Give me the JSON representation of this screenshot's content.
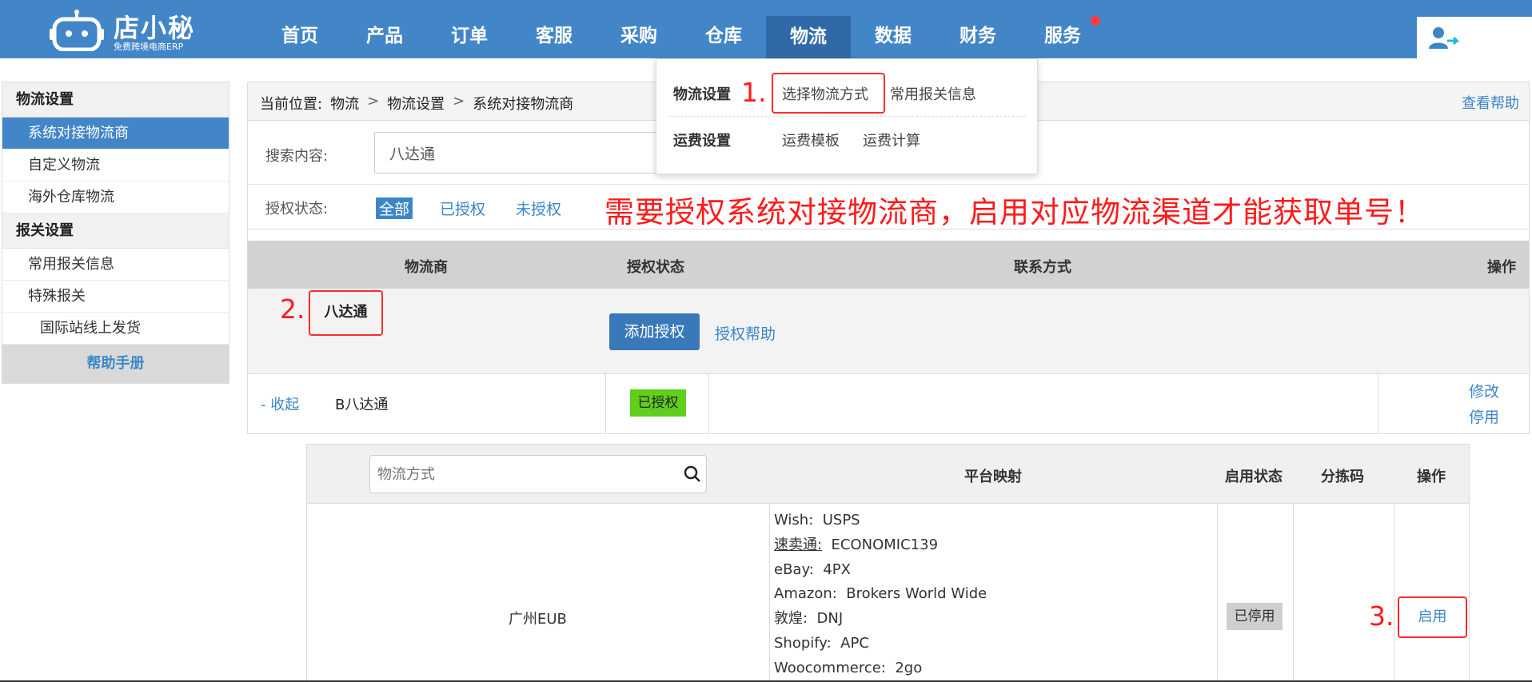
{
  "header": {
    "logo_name": "店小秘",
    "logo_sub": "免费跨境电商ERP",
    "nav": [
      "首页",
      "产品",
      "订单",
      "客服",
      "采购",
      "仓库",
      "物流",
      "数据",
      "财务",
      "服务"
    ],
    "active_nav": "物流",
    "colors": {
      "bar": "#4386c8",
      "active": "#3169a8",
      "dot": "#ff3b3b"
    }
  },
  "dropdown": {
    "group1_label": "物流设置",
    "group1_items": [
      "选择物流方式",
      "常用报关信息"
    ],
    "group2_label": "运费设置",
    "group2_items": [
      "运费模板",
      "运费计算"
    ],
    "annotation": "1."
  },
  "sidebar": {
    "section1": "物流设置",
    "section1_items": [
      "系统对接物流商",
      "自定义物流",
      "海外仓库物流"
    ],
    "section2": "报关设置",
    "section2_items": [
      "常用报关信息",
      "特殊报关"
    ],
    "sub_item": "国际站线上发货",
    "help": "帮助手册"
  },
  "breadcrumb": {
    "prefix": "当前位置:",
    "parts": [
      "物流",
      "物流设置",
      "系统对接物流商"
    ],
    "sep": ">",
    "help_link": "查看帮助"
  },
  "search": {
    "label": "搜索内容:",
    "value": "八达通"
  },
  "auth_filter": {
    "label": "授权状态:",
    "options": [
      "全部",
      "已授权",
      "未授权"
    ],
    "selected": "全部"
  },
  "notice": "需要授权系统对接物流商，启用对应物流渠道才能获取单号！",
  "table": {
    "headers": [
      "物流商",
      "授权状态",
      "联系方式",
      "操作"
    ],
    "provider": "八达通",
    "provider_annotation": "2.",
    "add_auth_button": "添加授权",
    "auth_help": "授权帮助",
    "row": {
      "collapse": "- 收起",
      "account": "B八达通",
      "status": "已授权",
      "ops": [
        "修改",
        "停用"
      ]
    }
  },
  "subtable": {
    "search_placeholder": "物流方式",
    "headers": [
      "平台映射",
      "启用状态",
      "分拣码",
      "操作"
    ],
    "method": "广州EUB",
    "mappings": [
      {
        "platform": "Wish:",
        "value": "USPS"
      },
      {
        "platform": "速卖通:",
        "value": "ECONOMIC139"
      },
      {
        "platform": "eBay:",
        "value": "4PX"
      },
      {
        "platform": "Amazon:",
        "value": "Brokers World Wide"
      },
      {
        "platform": "敦煌:",
        "value": "DNJ"
      },
      {
        "platform": "Shopify:",
        "value": "APC"
      },
      {
        "platform": "Woocommerce:",
        "value": "2go"
      }
    ],
    "status": "已停用",
    "action": "启用",
    "action_annotation": "3."
  }
}
